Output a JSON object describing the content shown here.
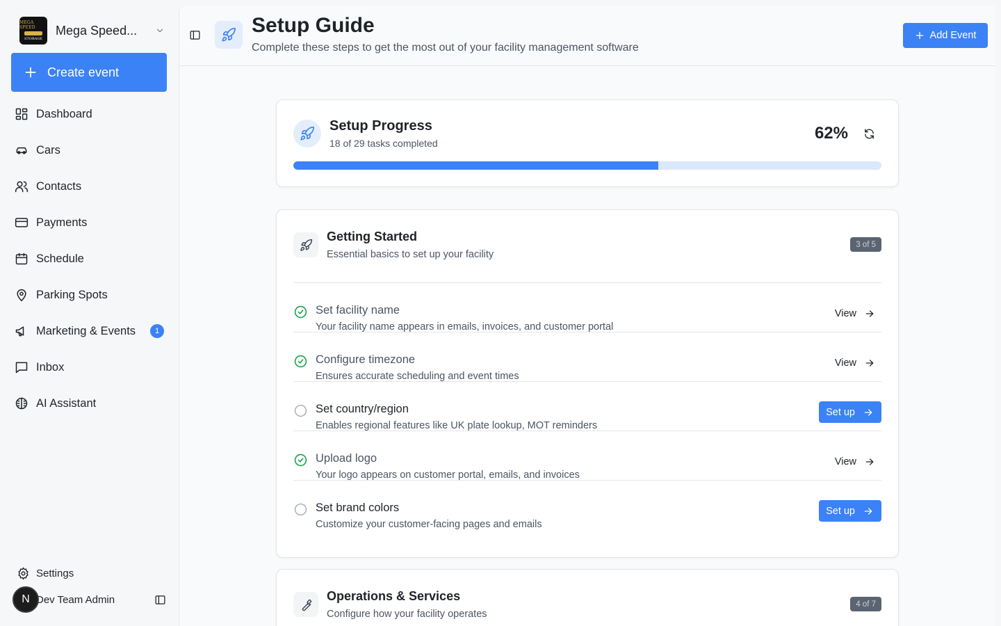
{
  "org": {
    "name": "Mega Speed...",
    "logo_line1": "MEGA SPEED",
    "logo_line2": "STORAGE"
  },
  "sidebar": {
    "create_label": "Create event",
    "items": [
      {
        "label": "Dashboard",
        "icon": "dashboard-icon"
      },
      {
        "label": "Cars",
        "icon": "car-icon"
      },
      {
        "label": "Contacts",
        "icon": "users-icon"
      },
      {
        "label": "Payments",
        "icon": "credit-card-icon"
      },
      {
        "label": "Schedule",
        "icon": "calendar-icon"
      },
      {
        "label": "Parking Spots",
        "icon": "map-pin-icon"
      },
      {
        "label": "Marketing & Events",
        "icon": "megaphone-icon",
        "badge": "1"
      },
      {
        "label": "Inbox",
        "icon": "message-icon"
      },
      {
        "label": "AI Assistant",
        "icon": "brain-icon"
      }
    ],
    "settings_label": "Settings",
    "user": {
      "initial": "N",
      "name": "Dev Team Admin"
    }
  },
  "header": {
    "title": "Setup Guide",
    "subtitle": "Complete these steps to get the most out of your facility management software",
    "add_event_label": "Add Event"
  },
  "progress": {
    "title": "Setup Progress",
    "subtitle": "18 of 29 tasks completed",
    "percent_label": "62%",
    "percent_value": 0.62
  },
  "sections": [
    {
      "title": "Getting Started",
      "subtitle": "Essential basics to set up your facility",
      "badge": "3 of 5",
      "tasks": [
        {
          "title": "Set facility name",
          "desc": "Your facility name appears in emails, invoices, and customer portal",
          "done": true,
          "action": "View"
        },
        {
          "title": "Configure timezone",
          "desc": "Ensures accurate scheduling and event times",
          "done": true,
          "action": "View"
        },
        {
          "title": "Set country/region",
          "desc": "Enables regional features like UK plate lookup, MOT reminders",
          "done": false,
          "action": "Set up"
        },
        {
          "title": "Upload logo",
          "desc": "Your logo appears on customer portal, emails, and invoices",
          "done": true,
          "action": "View"
        },
        {
          "title": "Set brand colors",
          "desc": "Customize your customer-facing pages and emails",
          "done": false,
          "action": "Set up"
        }
      ]
    },
    {
      "title": "Operations & Services",
      "subtitle": "Configure how your facility operates",
      "badge": "4 of 7"
    }
  ],
  "colors": {
    "accent": "#3b82f6",
    "success": "#16a34a",
    "progress_track": "#dbe7fb"
  }
}
